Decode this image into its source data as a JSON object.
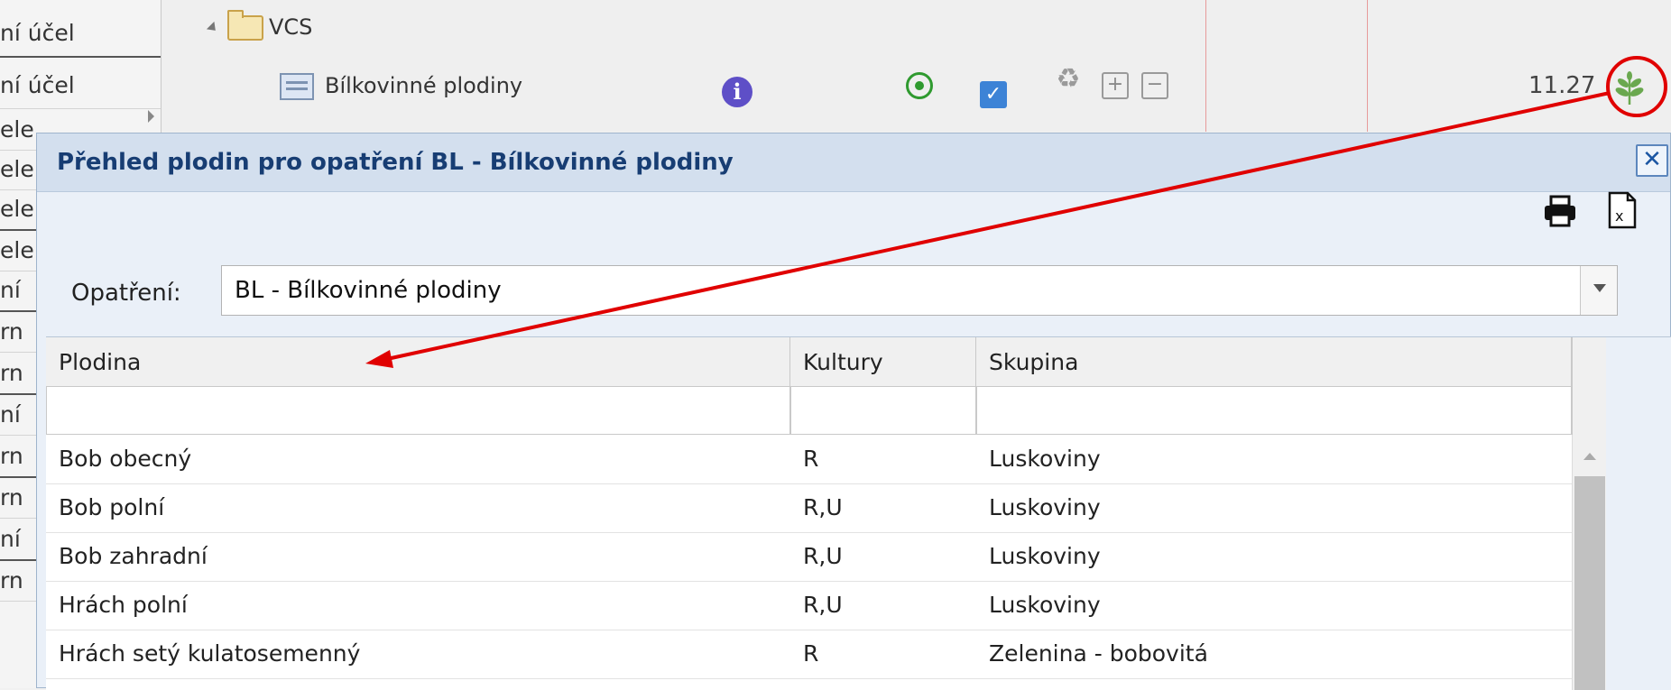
{
  "sidebar": {
    "items": [
      "ní účel",
      "ní účel",
      "ele",
      "ele",
      "ele",
      "ele",
      "ní",
      "rn",
      "rn",
      "ní",
      "rn",
      "rn",
      "ní",
      "rn"
    ]
  },
  "tree": {
    "folder_label": "VCS",
    "item_label": "Bílkovinné plodiny",
    "value": "11.27"
  },
  "icons": {
    "info": "info-icon",
    "target": "radio-target-icon",
    "check": "checkbox-checked-icon",
    "recycle": "recycle-icon",
    "plus": "plus-box-icon",
    "minus": "minus-box-icon",
    "leaf": "plant-leaf-icon",
    "print": "printer-icon",
    "xls": "excel-export-icon",
    "close": "close-icon"
  },
  "colors": {
    "title_text": "#173d73",
    "annotation": "#e00000",
    "leaf": "#6aa84f"
  },
  "modal": {
    "title": "Přehled plodin pro opatření BL - Bílkovinné plodiny",
    "close_glyph": "✕",
    "opatreni_label": "Opatření:",
    "opatreni_value": "BL - Bílkovinné plodiny"
  },
  "grid": {
    "columns": [
      "Plodina",
      "Kultury",
      "Skupina"
    ],
    "rows": [
      [
        "Bob obecný",
        "R",
        "Luskoviny"
      ],
      [
        "Bob polní",
        "R,U",
        "Luskoviny"
      ],
      [
        "Bob zahradní",
        "R,U",
        "Luskoviny"
      ],
      [
        "Hrách polní",
        "R,U",
        "Luskoviny"
      ],
      [
        "Hrách setý kulatosemenný",
        "R",
        "Zelenina - bobovitá"
      ]
    ]
  }
}
